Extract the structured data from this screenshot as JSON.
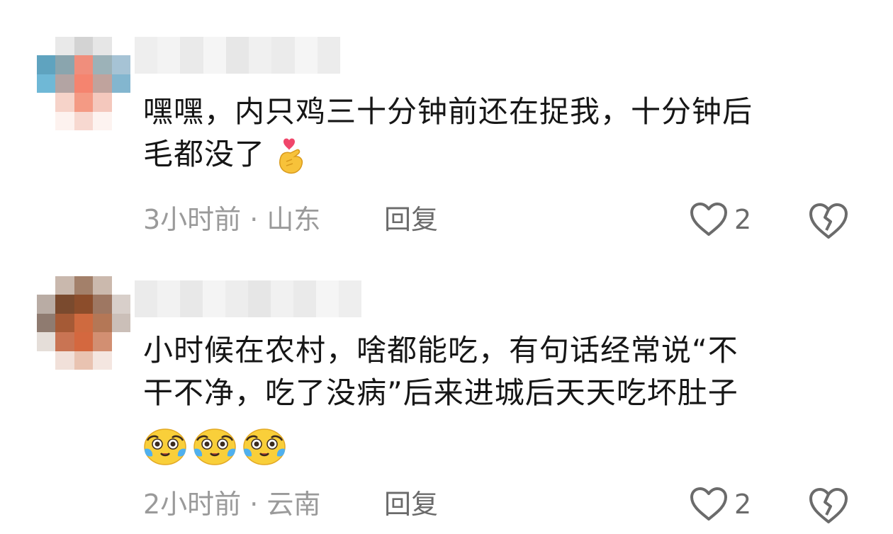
{
  "comments": [
    {
      "text_line1": "嘿嘿，内只鸡三十分钟前还在捉我，十分钟后",
      "text_line2": "毛都没了",
      "meta": "3小时前 · 山东",
      "reply_label": "回复",
      "like_count": "2",
      "emoji": "finger-heart-emoji"
    },
    {
      "text_line1": "小时候在农村，啥都能吃，有句话经常说“不",
      "text_line2": "干不净，吃了没病”后来进城后天天吃坏肚子",
      "meta": "2小时前 · 云南",
      "reply_label": "回复",
      "like_count": "2",
      "emoji": "crying-laughing-emoji"
    }
  ],
  "colors": {
    "text": "#161616",
    "meta": "#9a9a9a",
    "action": "#6b6b6b"
  }
}
